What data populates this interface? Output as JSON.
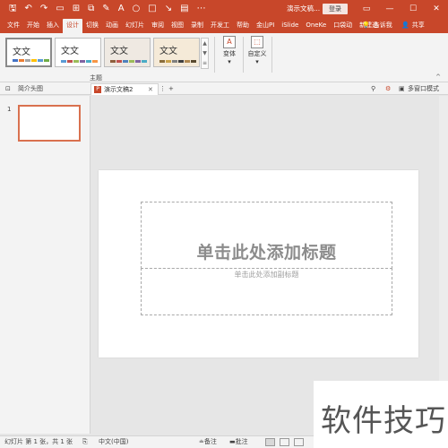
{
  "titlebar": {
    "quick_access": [
      {
        "name": "save-icon",
        "glyph": "🖫"
      },
      {
        "name": "undo-icon",
        "glyph": "↶"
      },
      {
        "name": "redo-icon",
        "glyph": "↷"
      },
      {
        "name": "slides-icon",
        "glyph": "▭"
      },
      {
        "name": "format-icon",
        "glyph": "⊞"
      },
      {
        "name": "arrange-icon",
        "glyph": "⧉"
      },
      {
        "name": "pen-icon",
        "glyph": "✎"
      },
      {
        "name": "text-icon",
        "glyph": "A"
      },
      {
        "name": "shape-circle-icon",
        "glyph": "○"
      },
      {
        "name": "shape-rect-icon",
        "glyph": "□"
      },
      {
        "name": "arrow-icon",
        "glyph": "↘"
      },
      {
        "name": "layout-icon",
        "glyph": "▤"
      },
      {
        "name": "more-icon",
        "glyph": "⋯"
      }
    ],
    "doc_title": "演示文稿...",
    "login_label": "登录",
    "controls": [
      "▭",
      "—",
      "☐",
      "✕"
    ]
  },
  "menu": {
    "tabs": [
      "文件",
      "开始",
      "插入",
      "设计",
      "切换",
      "动画",
      "幻灯片",
      "审阅",
      "视图",
      "录制",
      "开发工",
      "帮助",
      "金山PI",
      "iSlide",
      "OneKe",
      "口袋动",
      "新建选"
    ],
    "active_index": 3,
    "tell_me": "告诉我",
    "share": "共享"
  },
  "ribbon": {
    "themes": [
      {
        "label": "文文",
        "selected": true,
        "colors": [
          "#4472c4",
          "#ed7d31",
          "#a5a5a5",
          "#ffc000",
          "#5b9bd5",
          "#70ad47"
        ]
      },
      {
        "label": "文文",
        "selected": false,
        "colors": [
          "#5b9bd5",
          "#c0504d",
          "#9bbb59",
          "#8064a2",
          "#4bacc6",
          "#f79646"
        ]
      },
      {
        "label": "文文",
        "selected": false,
        "colors": [
          "#8e5e3c",
          "#c0504d",
          "#4f81bd",
          "#9bbb59",
          "#8064a2",
          "#4bacc6"
        ]
      },
      {
        "label": "文文",
        "selected": false,
        "colors": [
          "#8a6d3b",
          "#c9a14a",
          "#7f7f7f",
          "#3f3f3f",
          "#b08850",
          "#594a2f"
        ]
      }
    ],
    "group_label": "主题",
    "variants_label": "变体",
    "customize_label": "自定义"
  },
  "tabstrip": {
    "pane_label": "简介头图",
    "doc_tab": "演示文稿2",
    "multi_window": "多窗口模式"
  },
  "slides_pane": {
    "thumb_number": "1"
  },
  "slide": {
    "title_placeholder": "单击此处添加标题",
    "subtitle_placeholder": "单击此处添加副标题"
  },
  "statusbar": {
    "slide_info": "幻灯片 第 1 张，共 1 张",
    "language": "中文(中国)",
    "notes": "备注",
    "comments": "批注"
  },
  "watermark": "软件技巧"
}
